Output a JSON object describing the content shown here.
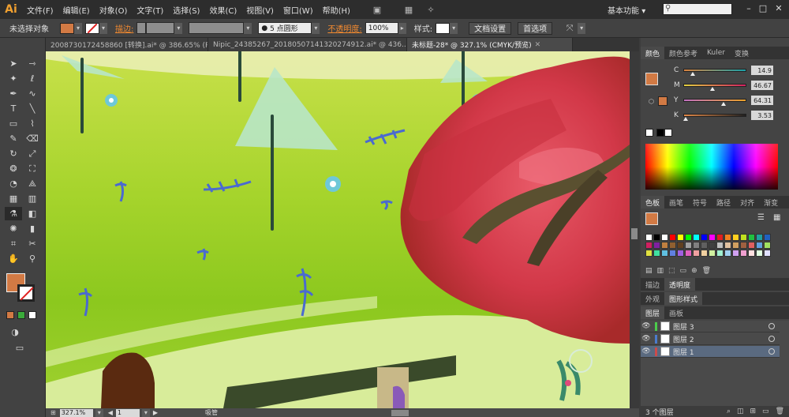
{
  "app": {
    "logo": "Ai"
  },
  "menubar": {
    "items": [
      "文件(F)",
      "编辑(E)",
      "对象(O)",
      "文字(T)",
      "选择(S)",
      "效果(C)",
      "视图(V)",
      "窗口(W)",
      "帮助(H)"
    ],
    "workspace": "基本功能",
    "workspace_arrow": "▾",
    "search_placeholder": ""
  },
  "controlbar": {
    "selection_status": "未选择对象",
    "stroke_label": "描边:",
    "stroke_weight_value": "",
    "brush_label": "5 点圆形",
    "opacity_label": "不透明度:",
    "opacity_value": "100%",
    "style_label": "样式:",
    "doc_setup_button": "文档设置",
    "prefs_button": "首选项"
  },
  "doctabs": [
    {
      "label": "20087301724588​60 [转换].ai* @ 386.65% (RGB/预..."
    },
    {
      "label": "Nipic_24385267_20180507141320274912.ai* @ 436..."
    },
    {
      "label": "未标题-28* @ 327.1% (CMYK/预览)"
    }
  ],
  "colors": {
    "fill": "#d27a44",
    "accent_orange": "#f28a30",
    "canvas_green": "#9bd02a",
    "blossom_red": "#d83848"
  },
  "color_panel": {
    "tabs": [
      "颜色",
      "颜色参考",
      "Kuler",
      "变换"
    ],
    "channels": [
      {
        "letter": "C",
        "value": "14.9",
        "fraction": 0.149
      },
      {
        "letter": "M",
        "value": "46.67",
        "fraction": 0.4667
      },
      {
        "letter": "Y",
        "value": "64.31",
        "fraction": 0.6431
      },
      {
        "letter": "K",
        "value": "3.53",
        "fraction": 0.0353
      }
    ]
  },
  "swatches_panel": {
    "tabs": [
      "色板",
      "画笔",
      "符号",
      "路径",
      "对齐",
      "渐变"
    ]
  },
  "stroke_panel": {
    "tabs": [
      "描边",
      "透明度"
    ]
  },
  "appearance_panel": {
    "tabs": [
      "外观",
      "图形样式"
    ]
  },
  "layers_panel": {
    "tabs": [
      "图层",
      "画板"
    ],
    "layers": [
      {
        "name": "图层 3",
        "color": "#4bcc4b",
        "visible": true
      },
      {
        "name": "图层 2",
        "color": "#4b7bcc",
        "visible": true
      },
      {
        "name": "图层 1",
        "color": "#cc4b4b",
        "visible": true
      }
    ],
    "count_label": "3 个图层"
  },
  "statusbar": {
    "zoom": "327.1%",
    "page": "1",
    "tool_label": "吸管"
  },
  "tools": [
    "selection-icon",
    "direct-selection-icon",
    "magic-wand-icon",
    "lasso-icon",
    "pen-icon",
    "curvature-icon",
    "type-icon",
    "line-icon",
    "rectangle-icon",
    "brush-icon",
    "pencil-icon",
    "eraser-icon",
    "rotate-icon",
    "scale-icon",
    "warp-icon",
    "free-transform-icon",
    "shape-builder-icon",
    "perspective-icon",
    "mesh-icon",
    "gradient-icon",
    "eyedropper-icon",
    "blend-icon",
    "symbol-sprayer-icon",
    "graph-icon",
    "artboard-icon",
    "slice-icon",
    "hand-icon",
    "zoom-icon"
  ]
}
